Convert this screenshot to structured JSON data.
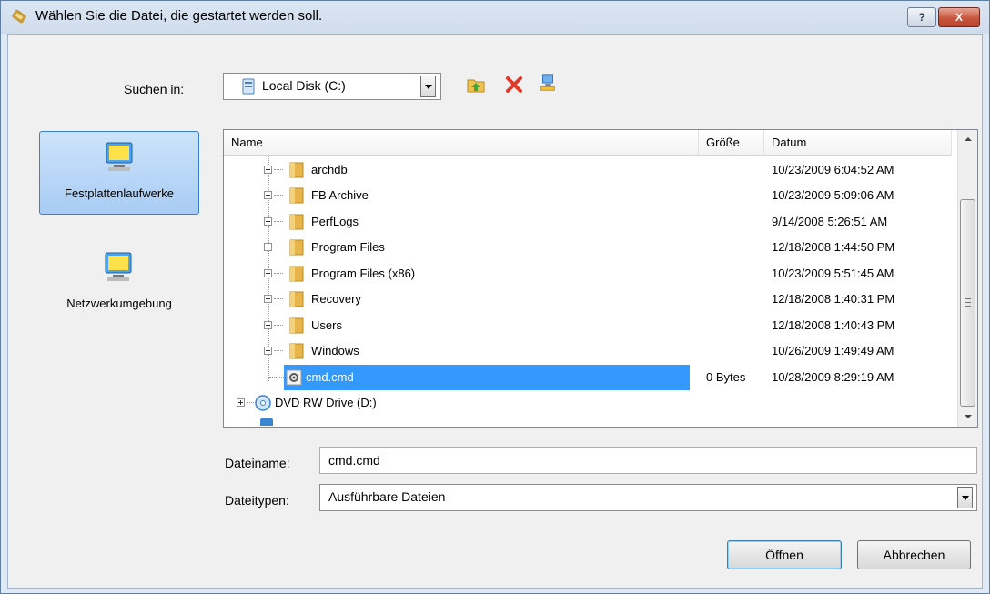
{
  "window": {
    "title": "Wählen Sie die Datei, die gestartet werden soll.",
    "help_label": "?",
    "close_label": "X"
  },
  "lookin": {
    "label": "Suchen in:",
    "value": "Local Disk (C:)"
  },
  "toolbar": {
    "icons": [
      "folder-up-icon",
      "delete-icon",
      "network-icon"
    ]
  },
  "places": [
    {
      "label": "Festplattenlaufwerke",
      "selected": true
    },
    {
      "label": "Netzwerkumgebung",
      "selected": false
    }
  ],
  "list": {
    "columns": [
      "Name",
      "Größe",
      "Datum"
    ],
    "rows": [
      {
        "name": "archdb",
        "size": "",
        "date": "10/23/2009 6:04:52 AM"
      },
      {
        "name": "FB Archive",
        "size": "",
        "date": "10/23/2009 5:09:06 AM"
      },
      {
        "name": "PerfLogs",
        "size": "",
        "date": "9/14/2008 5:26:51 AM"
      },
      {
        "name": "Program Files",
        "size": "",
        "date": "12/18/2008 1:44:50 PM"
      },
      {
        "name": "Program Files (x86)",
        "size": "",
        "date": "10/23/2009 5:51:45 AM"
      },
      {
        "name": "Recovery",
        "size": "",
        "date": "12/18/2008 1:40:31 PM"
      },
      {
        "name": "Users",
        "size": "",
        "date": "12/18/2008 1:40:43 PM"
      },
      {
        "name": "Windows",
        "size": "",
        "date": "10/26/2009 1:49:49 AM"
      },
      {
        "name": "cmd.cmd",
        "size": "0 Bytes",
        "date": "10/28/2009 8:29:19 AM"
      },
      {
        "name": "DVD RW Drive (D:)",
        "size": "",
        "date": ""
      }
    ]
  },
  "filename": {
    "label": "Dateiname:",
    "value": "cmd.cmd"
  },
  "filetype": {
    "label": "Dateitypen:",
    "value": "Ausführbare Dateien"
  },
  "buttons": {
    "open": "Öffnen",
    "cancel": "Abbrechen"
  },
  "colors": {
    "selection": "#3399ff",
    "folder": "#e8b54c"
  }
}
